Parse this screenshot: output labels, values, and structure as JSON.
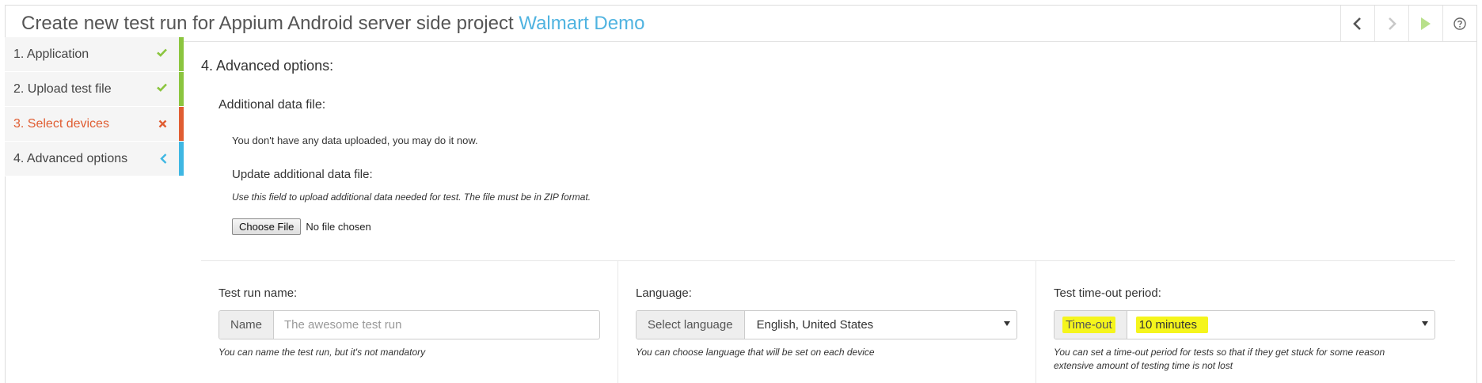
{
  "header": {
    "title_prefix": "Create new test run for Appium Android server side project ",
    "project_name": "Walmart Demo"
  },
  "toolbar": {
    "buttons": [
      "previous",
      "next",
      "run",
      "help"
    ]
  },
  "sidebar": {
    "steps": [
      {
        "label": "1. Application",
        "status": "done"
      },
      {
        "label": "2. Upload test file",
        "status": "done"
      },
      {
        "label": "3. Select devices",
        "status": "error"
      },
      {
        "label": "4. Advanced options",
        "status": "current"
      }
    ]
  },
  "main": {
    "section_title": "4. Advanced options:",
    "data_file": {
      "title": "Additional data file:",
      "note": "You don't have any data uploaded, you may do it now.",
      "update_title": "Update additional data file:",
      "help": "Use this field to upload additional data needed for test. The file must be in ZIP format.",
      "choose_button": "Choose File",
      "no_file": "No file chosen"
    },
    "test_run_name": {
      "label": "Test run name:",
      "addon": "Name",
      "placeholder": "The awesome test run",
      "help": "You can name the test run, but it's not mandatory"
    },
    "language": {
      "label": "Language:",
      "addon": "Select language",
      "value": "English, United States",
      "help": "You can choose language that will be set on each device"
    },
    "timeout": {
      "label": "Test time-out period:",
      "addon": "Time-out",
      "value": "10 minutes",
      "help_line1": "You can set a time-out period for tests so that if they get stuck for some reason",
      "help_line2": "extensive amount of testing time is not lost"
    }
  },
  "colors": {
    "done": "#8bc53f",
    "error": "#e05d32",
    "current": "#3fb7e3",
    "link": "#4fb3e0",
    "highlight": "#f5f51c"
  }
}
